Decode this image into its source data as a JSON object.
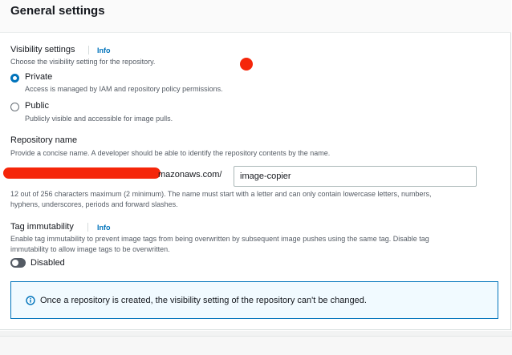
{
  "panel": {
    "title": "General settings"
  },
  "visibility": {
    "label": "Visibility settings",
    "info": "Info",
    "description": "Choose the visibility setting for the repository.",
    "selected": "Private",
    "options": [
      {
        "label": "Private",
        "description": "Access is managed by IAM and repository policy permissions."
      },
      {
        "label": "Public",
        "description": "Publicly visible and accessible for image pulls."
      }
    ]
  },
  "repository": {
    "label": "Repository name",
    "description": "Provide a concise name. A developer should be able to identify the repository contents by the name.",
    "uri_suffix": "mazonaws.com/",
    "value": "image-copier",
    "hint_line1": "12 out of 256 characters maximum (2 minimum). The name must start with a letter and can only contain lowercase letters, numbers,",
    "hint_line2": "hyphens, underscores, periods and forward slashes."
  },
  "tag_immutability": {
    "label": "Tag immutability",
    "info": "Info",
    "description_line1": "Enable tag immutability to prevent image tags from being overwritten by subsequent image pushes using the same tag. Disable tag",
    "description_line2": "immutability to allow image tags to be overwritten.",
    "state": "Disabled",
    "enabled": false
  },
  "alert": {
    "text": "Once a repository is created, the visibility setting of the repository can't be changed."
  },
  "colors": {
    "accent": "#0073bb",
    "redaction": "#f5260a",
    "alert_bg": "#f1faff"
  }
}
